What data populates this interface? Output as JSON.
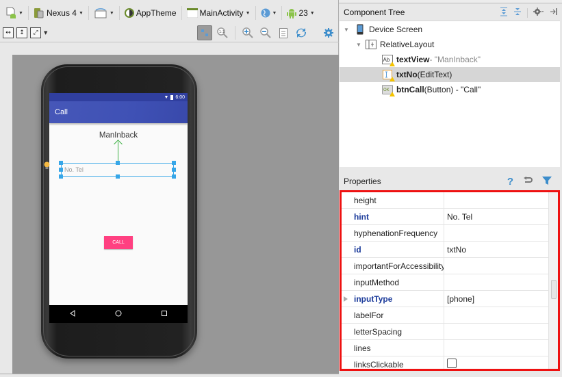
{
  "toolbar": {
    "device": "Nexus 4",
    "theme": "AppTheme",
    "activity": "MainActivity",
    "api_level": "23"
  },
  "phone": {
    "status_time": "6:00",
    "app_title": "Call",
    "textview_text": "ManInback",
    "edittext_hint": "No. Tel",
    "button_label": "CALL"
  },
  "component_tree": {
    "title": "Component Tree",
    "items": [
      {
        "name": "Device Screen",
        "detail": ""
      },
      {
        "name": "RelativeLayout",
        "detail": ""
      },
      {
        "name": "textView",
        "detail": " - \"ManInback\""
      },
      {
        "name": "txtNo",
        "detail": " (EditText)"
      },
      {
        "name": "btnCall",
        "detail": " (Button) - \"Call\""
      }
    ]
  },
  "properties": {
    "title": "Properties",
    "rows": [
      {
        "name": "height",
        "value": ""
      },
      {
        "name": "hint",
        "value": "No. Tel"
      },
      {
        "name": "hyphenationFrequency",
        "value": ""
      },
      {
        "name": "id",
        "value": "txtNo"
      },
      {
        "name": "importantForAccessibility",
        "value": ""
      },
      {
        "name": "inputMethod",
        "value": ""
      },
      {
        "name": "inputType",
        "value": "[phone]"
      },
      {
        "name": "labelFor",
        "value": ""
      },
      {
        "name": "letterSpacing",
        "value": ""
      },
      {
        "name": "lines",
        "value": ""
      },
      {
        "name": "linksClickable",
        "value": ""
      }
    ]
  },
  "colors": {
    "highlight_border": "#ee1111",
    "primary": "#3f51b5",
    "primary_dark": "#303f9f",
    "accent": "#ff4081",
    "selection": "#36a6e8"
  }
}
